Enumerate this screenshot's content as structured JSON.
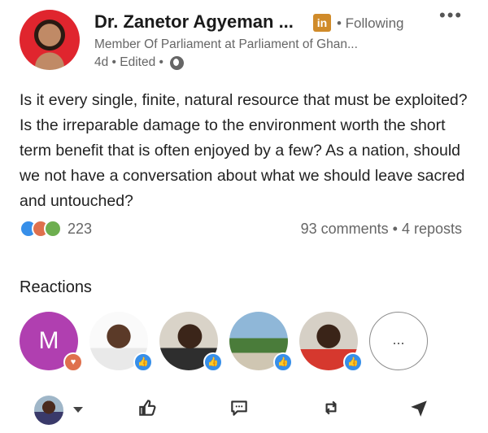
{
  "post": {
    "author_name": "Dr. Zanetor Agyeman ...",
    "network_badge": "in",
    "follow_status": "• Following",
    "more_menu": "•••",
    "headline": "Member Of Parliament at Parliament of Ghan...",
    "time_meta": "4d • Edited •",
    "body": "Is it every single, finite, natural resource that must be exploited? Is the irreparable damage to the environment worth the short term benefit that is often enjoyed by a few? As a nation, should we not have a conversation about what we should leave sacred and untouched?",
    "reaction_count": "223",
    "comments_reposts": "93 comments • 4 reposts"
  },
  "reactions": {
    "title": "Reactions",
    "first_initial": "M",
    "more_label": "..."
  },
  "icons": {
    "reaction_types": [
      "like-icon",
      "love-icon",
      "support-icon"
    ],
    "actions": [
      "like-icon",
      "comment-icon",
      "repost-icon",
      "send-icon"
    ]
  },
  "colors": {
    "like": "#378fe9",
    "love": "#df704d",
    "linkedin_badge": "#d08b2a"
  }
}
